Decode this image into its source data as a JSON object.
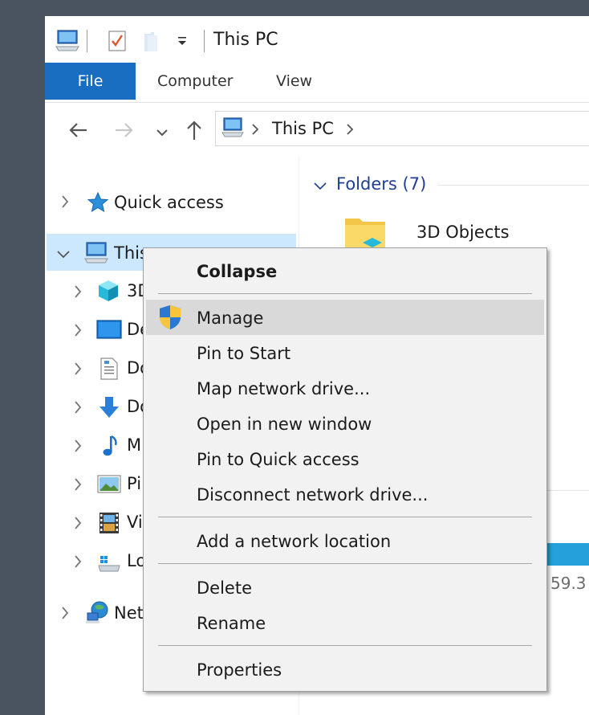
{
  "window": {
    "title": "This PC"
  },
  "ribbon": {
    "tabs": [
      {
        "label": "File"
      },
      {
        "label": "Computer"
      },
      {
        "label": "View"
      }
    ]
  },
  "address_bar": {
    "path": "This PC"
  },
  "tree": {
    "quick_access": "Quick access",
    "this_pc": "This",
    "children": [
      {
        "label": "3D",
        "icon": "cube-3d-icon"
      },
      {
        "label": "De",
        "icon": "desktop-icon"
      },
      {
        "label": "Do",
        "icon": "documents-icon"
      },
      {
        "label": "Do",
        "icon": "downloads-icon"
      },
      {
        "label": "M",
        "icon": "music-icon"
      },
      {
        "label": "Pi",
        "icon": "pictures-icon"
      },
      {
        "label": "Vi",
        "icon": "videos-icon"
      },
      {
        "label": "Lo",
        "icon": "local-disk-icon"
      }
    ],
    "network": "Net"
  },
  "content": {
    "folders_header": "Folders (7)",
    "first_folder": "3D Objects",
    "drive_free_text": "59.3"
  },
  "context_menu": {
    "items": [
      {
        "label": "Collapse",
        "bold": true
      },
      {
        "label": "Manage",
        "highlighted": true,
        "icon": "uac-shield-icon"
      },
      {
        "label": "Pin to Start"
      },
      {
        "label": "Map network drive..."
      },
      {
        "label": "Open in new window"
      },
      {
        "label": "Pin to Quick access"
      },
      {
        "label": "Disconnect network drive..."
      },
      {
        "label": "Add a network location"
      },
      {
        "label": "Delete"
      },
      {
        "label": "Rename"
      },
      {
        "label": "Properties"
      }
    ]
  },
  "colors": {
    "accent": "#1a6ec2",
    "selection": "#cce8ff",
    "menu_background": "#f2f2f2",
    "menu_highlight": "#d9d9d9",
    "drive_bar": "#26a0da",
    "header_blue": "#1f3f93"
  }
}
